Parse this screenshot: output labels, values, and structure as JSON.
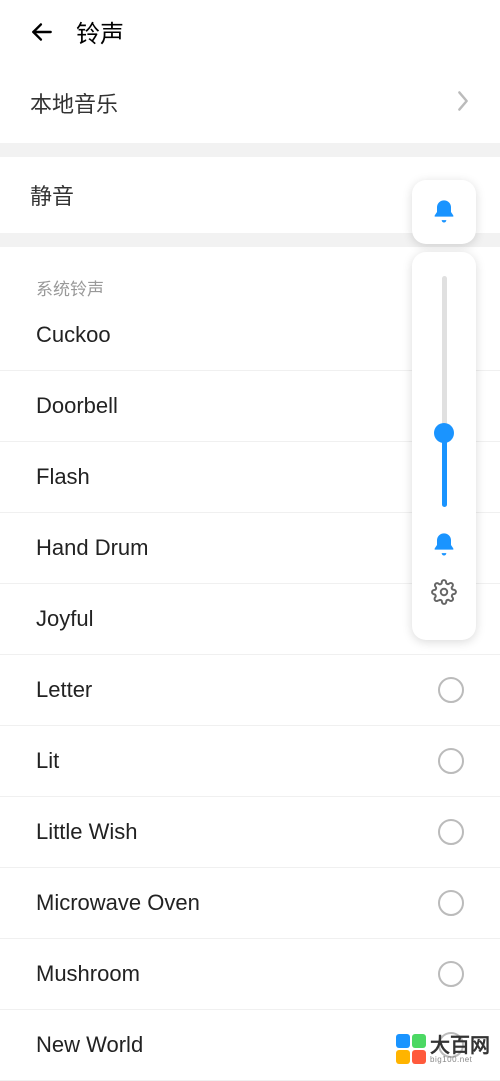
{
  "header": {
    "title": "铃声"
  },
  "localMusic": {
    "label": "本地音乐"
  },
  "silent": {
    "label": "静音"
  },
  "systemRingtones": {
    "header": "系统铃声",
    "items": [
      {
        "name": "Cuckoo"
      },
      {
        "name": "Doorbell"
      },
      {
        "name": "Flash"
      },
      {
        "name": "Hand Drum"
      },
      {
        "name": "Joyful"
      },
      {
        "name": "Letter"
      },
      {
        "name": "Lit"
      },
      {
        "name": "Little Wish"
      },
      {
        "name": "Microwave Oven"
      },
      {
        "name": "Mushroom"
      },
      {
        "name": "New World"
      }
    ]
  },
  "volume": {
    "level_percent": 32,
    "accent_color": "#1a94ff"
  },
  "watermark": {
    "text": "大百网",
    "sub": "big100.net"
  }
}
